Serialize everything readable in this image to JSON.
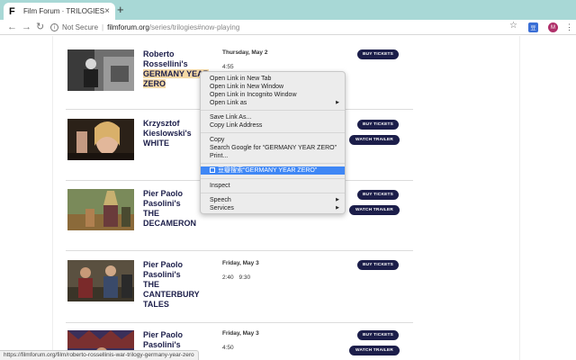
{
  "tab": {
    "favicon": "F",
    "title": "Film Forum · TRILOGIES",
    "close": "×"
  },
  "new_tab": "+",
  "toolbar": {
    "back": "←",
    "forward": "→",
    "reload": "↻",
    "info_glyph": "i",
    "not_secure": "Not Secure",
    "separator": "|",
    "url_host": "filmforum.org",
    "url_path": "/series/trilogies#now-playing",
    "star": "☆",
    "ext_label": "豆",
    "avatar_letter": "M",
    "menu": "⋮"
  },
  "films": [
    {
      "title_lines": [
        "Roberto",
        "Rossellini's"
      ],
      "title_highlight": [
        "GERMANY YEAR",
        "ZERO"
      ],
      "date": "Thursday, May 2",
      "times": "4:55",
      "buy": "BUY TICKETS",
      "trailer": ""
    },
    {
      "title_lines": [
        "Krzysztof",
        "Kieslowski's",
        "WHITE"
      ],
      "title_highlight": [],
      "date": "",
      "times": "",
      "buy": "BUY TICKETS",
      "trailer": "WATCH TRAILER"
    },
    {
      "title_lines": [
        "Pier Paolo",
        "Pasolini's",
        "THE",
        "DECAMERON"
      ],
      "title_highlight": [],
      "date": "",
      "times": "",
      "buy": "BUY TICKETS",
      "trailer": "WATCH TRAILER"
    },
    {
      "title_lines": [
        "Pier Paolo",
        "Pasolini's",
        "THE",
        "CANTERBURY",
        "TALES"
      ],
      "title_highlight": [],
      "date": "Friday, May 3",
      "times": "2:40  9:30",
      "buy": "BUY TICKETS",
      "trailer": ""
    },
    {
      "title_lines": [
        "Pier Paolo",
        "Pasolini's"
      ],
      "title_highlight": [],
      "date": "Friday, May 3",
      "times": "4:50",
      "buy": "BUY TICKETS",
      "trailer": "WATCH TRAILER"
    }
  ],
  "context_menu": {
    "items": [
      "Open Link in New Tab",
      "Open Link in New Window",
      "Open Link in Incognito Window",
      "Open Link as",
      "Save Link As...",
      "Copy Link Address",
      "Copy",
      "Search Google for “GERMANY YEAR ZERO”",
      "Print...",
      "豆瓣搜索“GERMANY YEAR ZERO”",
      "Inspect",
      "Speech",
      "Services"
    ],
    "submenu_arrow": "▶"
  },
  "status_url": "https://filmforum.org/film/roberto-rossellinis-war-trilogy-germany-year-zero"
}
